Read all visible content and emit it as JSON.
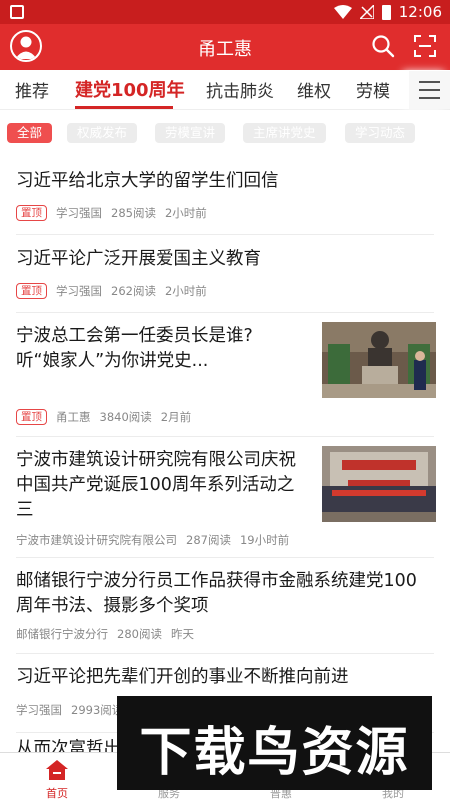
{
  "status_bar": {
    "time": "12:06"
  },
  "app_bar": {
    "title": "甬工惠"
  },
  "tabs": [
    {
      "label": "推荐"
    },
    {
      "label": "建党100周年"
    },
    {
      "label": "抗击肺炎"
    },
    {
      "label": "维权"
    },
    {
      "label": "劳模"
    }
  ],
  "chips": [
    {
      "label": "全部"
    },
    {
      "label": "权威发布"
    },
    {
      "label": "劳模宣讲"
    },
    {
      "label": "主席讲党史"
    },
    {
      "label": "学习动态"
    }
  ],
  "news": [
    {
      "title": "习近平给北京大学的留学生们回信",
      "pin": "置顶",
      "source": "学习强国",
      "reads": "285阅读",
      "time": "2小时前"
    },
    {
      "title": "习近平论广泛开展爱国主义教育",
      "pin": "置顶",
      "source": "学习强国",
      "reads": "262阅读",
      "time": "2小时前"
    },
    {
      "title_line1": "宁波总工会第一任委员长是谁?",
      "title_line2": "听“娘家人”为你讲党史...",
      "pin": "置顶",
      "source": "甬工惠",
      "reads": "3840阅读",
      "time": "2月前"
    },
    {
      "title_line1": "宁波市建筑设计研究院有限公司庆祝",
      "title_line2": "中国共产党诞辰100周年系列活动之",
      "title_line3": "三",
      "source": "宁波市建筑设计研究院有限公司",
      "reads": "287阅读",
      "time": "19小时前"
    },
    {
      "title_line1": "邮储银行宁波分行员工作品获得市金融系统建党100",
      "title_line2": "周年书法、摄影多个奖项",
      "source": "邮储银行宁波分行",
      "reads": "280阅读",
      "time": "昨天"
    },
    {
      "title": "习近平论把先辈们开创的事业不断推向前进",
      "source": "学习强国",
      "reads": "2993阅读"
    },
    {
      "title": "从而次富哲出"
    }
  ],
  "bottom_nav": [
    {
      "label": "首页"
    },
    {
      "label": "服务"
    },
    {
      "label": "普惠"
    },
    {
      "label": "我的"
    }
  ],
  "watermark": {
    "text": "下载鸟资源"
  },
  "colors": {
    "primary": "#e02d2d",
    "status_bar": "#c81e1e",
    "accent_text": "#d42525"
  }
}
